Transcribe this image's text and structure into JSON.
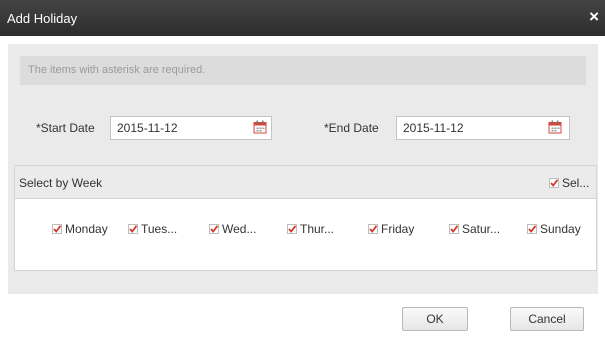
{
  "dialog": {
    "title": "Add Holiday",
    "close_icon": "close-icon"
  },
  "notice": "The items with asterisk are required.",
  "start_date": {
    "label": "*Start Date",
    "value": "2015-11-12",
    "icon": "calendar-icon"
  },
  "end_date": {
    "label": "*End Date",
    "value": "2015-11-12",
    "icon": "calendar-icon"
  },
  "week": {
    "title": "Select by Week",
    "select_all": {
      "label": "Sel...",
      "checked": true
    },
    "days": [
      {
        "label": "Monday",
        "checked": true
      },
      {
        "label": "Tues...",
        "checked": true
      },
      {
        "label": "Wed...",
        "checked": true
      },
      {
        "label": "Thur...",
        "checked": true
      },
      {
        "label": "Friday",
        "checked": true
      },
      {
        "label": "Satur...",
        "checked": true
      },
      {
        "label": "Sunday",
        "checked": true
      }
    ]
  },
  "buttons": {
    "ok": "OK",
    "cancel": "Cancel"
  },
  "colors": {
    "titlebar": "#333333",
    "check": "#d33a2c",
    "panel": "#eaeaea"
  }
}
